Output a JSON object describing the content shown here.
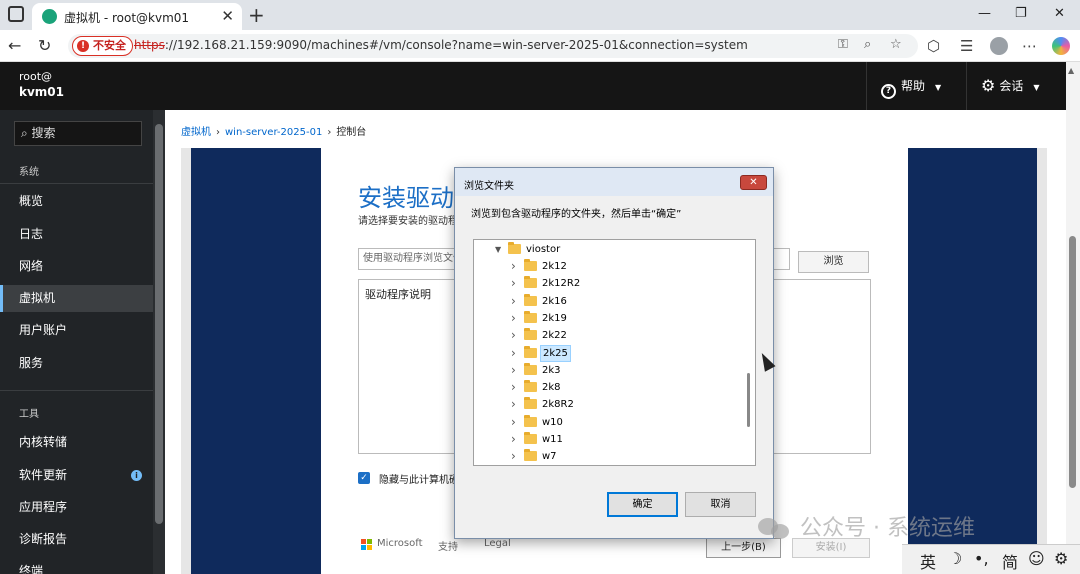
{
  "browser": {
    "tab_title": "虚拟机 - root@kvm01",
    "tab_close": "✕",
    "new_tab": "+",
    "insecure_label": "不安全",
    "insecure_icon": "!",
    "url_scheme": "https",
    "url_rest": "://192.168.21.159:9090/machines#/vm/console?name=win-server-2025-01&connection=system"
  },
  "cockpit": {
    "user": "root@",
    "host": "kvm01",
    "help_label": "帮助",
    "help_icon": "?",
    "session_label": "会话",
    "search_label": "搜索",
    "sections": {
      "system": "系统",
      "tools": "工具"
    },
    "system_items": [
      "概览",
      "日志",
      "网络",
      "虚拟机",
      "用户账户",
      "服务"
    ],
    "tools_items": [
      "内核转储",
      "软件更新",
      "应用程序",
      "诊断报告",
      "终端"
    ],
    "active_item": "虚拟机",
    "update_badge": "i",
    "breadcrumb": [
      "虚拟机",
      "win-server-2025-01",
      "控制台"
    ]
  },
  "setup": {
    "title": "安装驱动",
    "subtitle": "请选择要安装的驱动程",
    "input_placeholder": "使用驱动程序浏览文件",
    "browse": "浏览",
    "desc_label": "驱动程序说明",
    "checkbox_label": "隐藏与此计算机硬",
    "checkbox_mark": "✓",
    "footer_microsoft": "Microsoft",
    "footer_support": "支持",
    "footer_legal": "Legal",
    "back": "上一步(B)",
    "install": "安装(I)"
  },
  "dialog": {
    "title": "浏览文件夹",
    "close": "✕",
    "message": "浏览到包含驱动程序的文件夹，然后单击“确定”",
    "parent_folder": "viostor",
    "folders": [
      "2k12",
      "2k12R2",
      "2k16",
      "2k19",
      "2k22",
      "2k25",
      "2k3",
      "2k8",
      "2k8R2",
      "w10",
      "w11",
      "w7"
    ],
    "selected_folder": "2k25",
    "ok": "确定",
    "cancel": "取消"
  },
  "watermark": "公众号 · 系统运维",
  "ime": {
    "lang": "英",
    "moon": "☽",
    "punct": "•,",
    "script": "简",
    "emoji": "☺",
    "settings": "⚙"
  },
  "colors": {
    "cockpit_header": "#151515",
    "sidebar": "#212427",
    "link": "#0066cc",
    "console_bg": "#0f2a5c",
    "setup_title": "#1c6fc6",
    "folder": "#f4c24d"
  },
  "icons": [
    "window-icon",
    "favicon-icon",
    "back-icon",
    "reload-icon",
    "key-icon",
    "zoom-icon",
    "star-icon",
    "extensions-icon",
    "favorites-icon",
    "search-icon",
    "help-icon",
    "gear-icon",
    "chevron-down-icon",
    "folder-icon",
    "close-icon"
  ]
}
